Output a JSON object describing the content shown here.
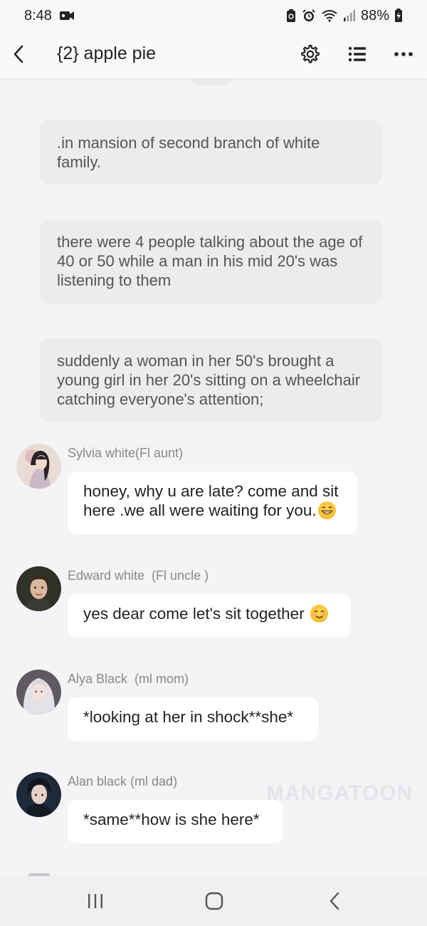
{
  "status_bar": {
    "time": "8:48",
    "battery": "88%"
  },
  "header": {
    "title": "{2} apple pie"
  },
  "narrations": [
    ".in mansion of second branch of white family.",
    "there were 4 people talking about the age of 40 or 50 while a man in his mid 20's was listening to them",
    "suddenly a woman in her 50's brought a young girl in her 20's sitting on a wheelchair  catching everyone's attention;"
  ],
  "messages": [
    {
      "speaker": "Sylvia white(Fl aunt)",
      "text": "honey, why u are late? come and sit here .we all were waiting for you.",
      "emoji": "grinning-emoji"
    },
    {
      "speaker": "Edward white  (Fl uncle )",
      "text": "yes dear come let's sit together ",
      "emoji": "smiling-emoji"
    },
    {
      "speaker": "Alya Black  (ml mom)",
      "text": "*looking at her in shock**she*"
    },
    {
      "speaker": "Alan black (ml dad)",
      "text": "*same**how is she here*"
    }
  ],
  "watermark": "MANGATOON",
  "colors": {
    "background": "#f4f4f6",
    "narration_bg": "#ececee",
    "bubble_bg": "#ffffff",
    "speaker_text": "#888888"
  }
}
